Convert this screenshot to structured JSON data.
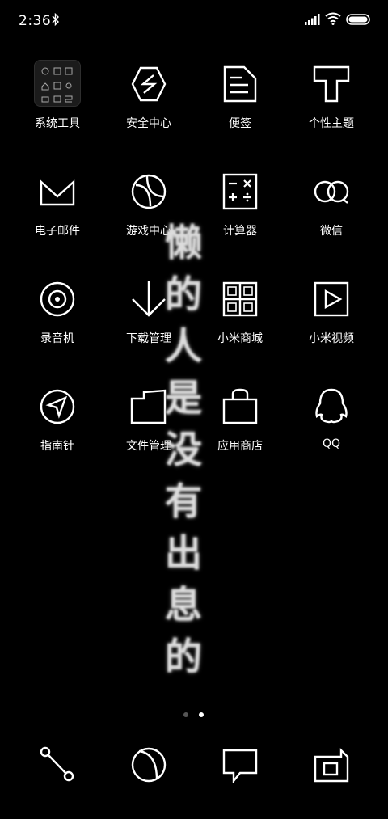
{
  "status_bar": {
    "time": "2:36",
    "icons": [
      "bluetooth-icon",
      "signal-icon",
      "wifi-icon",
      "battery-icon"
    ]
  },
  "home": {
    "apps": [
      {
        "label": "系统工具",
        "icon": "folder-icon"
      },
      {
        "label": "安全中心",
        "icon": "security-icon"
      },
      {
        "label": "便签",
        "icon": "notes-icon"
      },
      {
        "label": "个性主题",
        "icon": "themes-icon"
      },
      {
        "label": "电子邮件",
        "icon": "mail-icon"
      },
      {
        "label": "游戏中心",
        "icon": "game-center-icon"
      },
      {
        "label": "计算器",
        "icon": "calculator-icon"
      },
      {
        "label": "微信",
        "icon": "wechat-icon"
      },
      {
        "label": "录音机",
        "icon": "recorder-icon"
      },
      {
        "label": "下载管理",
        "icon": "download-icon"
      },
      {
        "label": "小米商城",
        "icon": "mi-store-icon"
      },
      {
        "label": "小米视频",
        "icon": "video-icon"
      },
      {
        "label": "指南针",
        "icon": "compass-icon"
      },
      {
        "label": "文件管理",
        "icon": "file-manager-icon"
      },
      {
        "label": "应用商店",
        "icon": "app-store-icon"
      },
      {
        "label": "QQ",
        "icon": "qq-icon"
      }
    ],
    "wallpaper_text": [
      "懒",
      "的",
      "人",
      "是",
      "没",
      "有",
      "出",
      "息",
      "的"
    ]
  },
  "page_indicator": {
    "current": 2,
    "total": 2
  },
  "dock": [
    "phone-icon",
    "browser-icon",
    "messages-icon",
    "camera-icon"
  ],
  "colors": {
    "background": "#000000",
    "foreground": "#ffffff"
  }
}
